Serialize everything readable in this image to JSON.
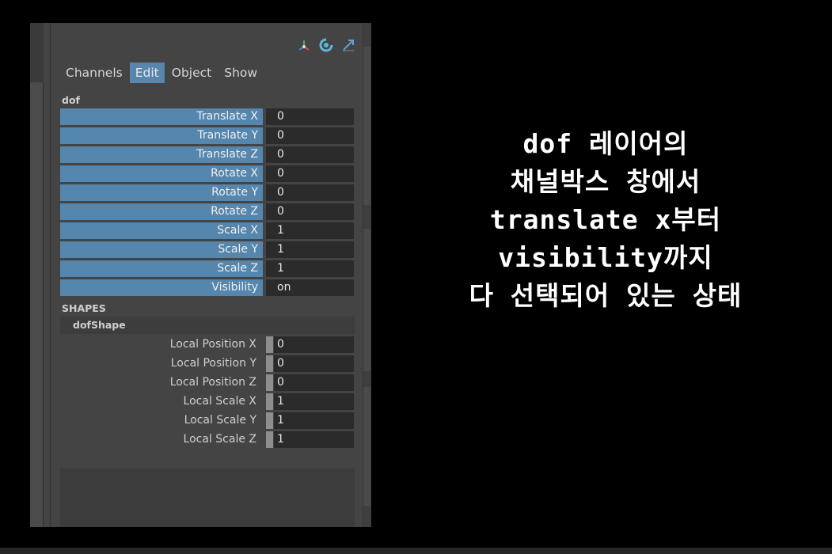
{
  "channel_box": {
    "menu": [
      "Channels",
      "Edit",
      "Object",
      "Show"
    ],
    "active_menu": "Edit",
    "icons": [
      "transform-axes-icon",
      "refresh-icon",
      "scale-arrow-icon"
    ],
    "node_name": "dof",
    "attributes": [
      {
        "name": "Translate X",
        "value": "0"
      },
      {
        "name": "Translate Y",
        "value": "0"
      },
      {
        "name": "Translate Z",
        "value": "0"
      },
      {
        "name": "Rotate X",
        "value": "0"
      },
      {
        "name": "Rotate Y",
        "value": "0"
      },
      {
        "name": "Rotate Z",
        "value": "0"
      },
      {
        "name": "Scale X",
        "value": "1"
      },
      {
        "name": "Scale Y",
        "value": "1"
      },
      {
        "name": "Scale Z",
        "value": "1"
      },
      {
        "name": "Visibility",
        "value": "on"
      }
    ],
    "shapes_label": "SHAPES",
    "shape_name": "dofShape",
    "shape_attributes": [
      {
        "name": "Local Position X",
        "value": "0"
      },
      {
        "name": "Local Position Y",
        "value": "0"
      },
      {
        "name": "Local Position Z",
        "value": "0"
      },
      {
        "name": "Local Scale X",
        "value": "1"
      },
      {
        "name": "Local Scale Y",
        "value": "1"
      },
      {
        "name": "Local Scale Z",
        "value": "1"
      }
    ],
    "colors": {
      "selected_row": "#5586ad",
      "active_menu": "#5a86ad",
      "panel": "#444444",
      "field": "#2b2b2b"
    }
  },
  "caption": {
    "lines": [
      "dof 레이어의",
      "채널박스 창에서",
      "translate x부터",
      "visibility까지",
      "다 선택되어 있는 상태"
    ]
  }
}
